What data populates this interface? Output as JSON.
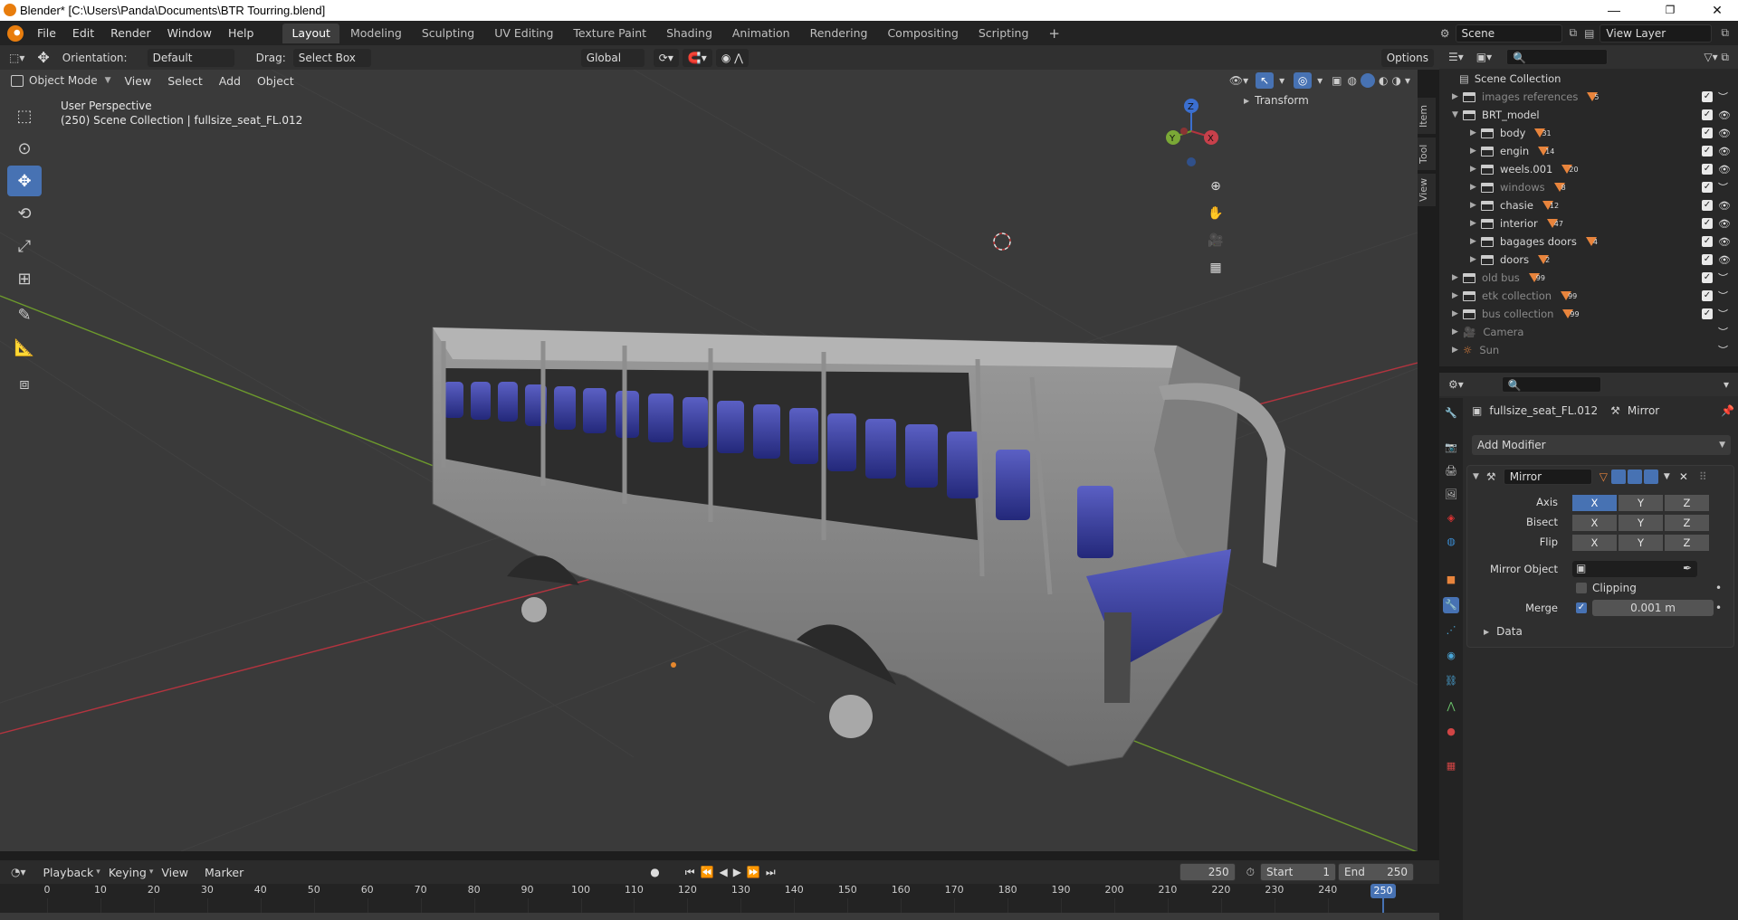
{
  "window": {
    "title": "Blender* [C:\\Users\\Panda\\Documents\\BTR Tourring.blend]",
    "minimize": "—",
    "maximize": "❐",
    "close": "✕"
  },
  "menus": [
    "File",
    "Edit",
    "Render",
    "Window",
    "Help"
  ],
  "workspaces": [
    "Layout",
    "Modeling",
    "Sculpting",
    "UV Editing",
    "Texture Paint",
    "Shading",
    "Animation",
    "Rendering",
    "Compositing",
    "Scripting"
  ],
  "workspace_add": "+",
  "scene": "Scene",
  "view_layer": "View Layer",
  "header": {
    "orientation_label": "Orientation:",
    "orientation_value": "Default",
    "drag_label": "Drag:",
    "drag_value": "Select Box",
    "transform_orient": "Global",
    "options": "Options"
  },
  "viewport_menu": {
    "mode": "Object Mode",
    "items": [
      "View",
      "Select",
      "Add",
      "Object"
    ]
  },
  "viewport": {
    "perspective": "User Perspective",
    "info": "(250) Scene Collection | fullsize_seat_FL.012",
    "transform_panel": "Transform",
    "side_tabs": [
      "Item",
      "Tool",
      "View"
    ],
    "gizmo": {
      "x": "X",
      "y": "Y",
      "z": "Z"
    }
  },
  "outliner": {
    "root": "Scene Collection",
    "rows": [
      {
        "name": "images references",
        "count": "5",
        "dim": true,
        "indent": 0
      },
      {
        "name": "BRT_model",
        "count": "",
        "dim": false,
        "indent": 0,
        "open": true
      },
      {
        "name": "body",
        "count": "31",
        "dim": false,
        "indent": 1
      },
      {
        "name": "engin",
        "count": "14",
        "dim": false,
        "indent": 1
      },
      {
        "name": "weels.001",
        "count": "20",
        "dim": false,
        "indent": 1
      },
      {
        "name": "windows",
        "count": "8",
        "dim": true,
        "indent": 1
      },
      {
        "name": "chasie",
        "count": "12",
        "dim": false,
        "indent": 1
      },
      {
        "name": "interior",
        "count": "47",
        "dim": false,
        "indent": 1
      },
      {
        "name": "bagages doors",
        "count": "4",
        "dim": false,
        "indent": 1
      },
      {
        "name": "doors",
        "count": "2",
        "dim": false,
        "indent": 1
      },
      {
        "name": "old bus",
        "count": "99",
        "dim": true,
        "indent": 0
      },
      {
        "name": "etk collection",
        "count": "99",
        "dim": true,
        "indent": 0
      },
      {
        "name": "bus collection",
        "count": "99",
        "dim": true,
        "indent": 0
      },
      {
        "name": "Camera",
        "count": "",
        "dim": true,
        "indent": 0
      },
      {
        "name": "Sun",
        "count": "",
        "dim": true,
        "indent": 0
      }
    ]
  },
  "properties": {
    "object": "fullsize_seat_FL.012",
    "modifier_crumb": "Mirror",
    "add_modifier": "Add Modifier",
    "modifier_name": "Mirror",
    "axis_label": "Axis",
    "bisect_label": "Bisect",
    "flip_label": "Flip",
    "axes": [
      "X",
      "Y",
      "Z"
    ],
    "axis_active": [
      true,
      false,
      false
    ],
    "mirror_object_label": "Mirror Object",
    "clipping_label": "Clipping",
    "merge_label": "Merge",
    "merge_value": "0.001 m",
    "data_label": "Data"
  },
  "timeline": {
    "menu": [
      "Playback",
      "Keying",
      "View",
      "Marker"
    ],
    "current_frame": "250",
    "start_label": "Start",
    "start": "1",
    "end_label": "End",
    "end": "250",
    "ticks": [
      "0",
      "10",
      "20",
      "30",
      "40",
      "50",
      "60",
      "70",
      "80",
      "90",
      "100",
      "110",
      "120",
      "130",
      "140",
      "150",
      "160",
      "170",
      "180",
      "190",
      "200",
      "210",
      "220",
      "230",
      "240"
    ],
    "playhead": "250"
  },
  "colors": {
    "accent": "#4772b3",
    "seat": "#3a3f9c",
    "body": "#8c8c8c",
    "x_axis": "#b3343f",
    "y_axis": "#6d9a2c"
  }
}
